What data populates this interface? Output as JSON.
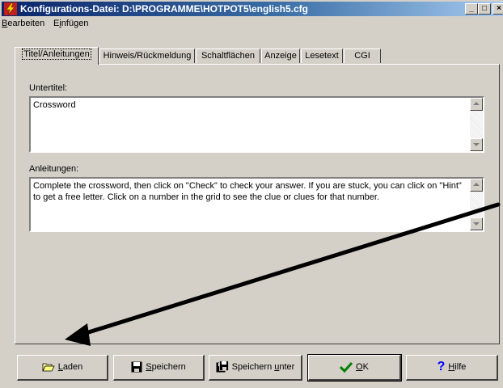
{
  "window": {
    "title": "Konfigurations-Datei: D:\\PROGRAMME\\HOTPOT5\\english5.cfg",
    "controls": {
      "minimize": "_",
      "maximize": "□",
      "close": "×"
    }
  },
  "menu": {
    "items": [
      {
        "label": "Bearbeiten",
        "mnemonic": "B",
        "rest": "earbeiten"
      },
      {
        "label": "Einfügen",
        "mnemonic": "i",
        "pre": "E",
        "rest": "nfügen"
      }
    ]
  },
  "tabs": [
    {
      "label": "Titel/Anleitungen",
      "active": true
    },
    {
      "label": "Hinweis/Rückmeldung",
      "active": false
    },
    {
      "label": "Schaltflächen",
      "active": false
    },
    {
      "label": "Anzeige",
      "active": false
    },
    {
      "label": "Lesetext",
      "active": false
    },
    {
      "label": "CGI",
      "active": false
    }
  ],
  "subtitle": {
    "label": "Untertitel:",
    "value": "Crossword"
  },
  "instructions": {
    "label": "Anleitungen:",
    "value": "Complete the crossword, then click on \"Check\" to check your answer. If you are stuck, you can click on \"Hint\" to get a free letter. Click on a number in the grid to see the clue or clues for that number."
  },
  "buttons": {
    "load": {
      "pre": "",
      "mnemonic": "L",
      "rest": "aden",
      "icon": "folder-open-icon"
    },
    "save": {
      "pre": "",
      "mnemonic": "S",
      "rest": "peichern",
      "icon": "floppy-disk-icon"
    },
    "save_as": {
      "pre": "Speichern ",
      "mnemonic": "u",
      "rest": "nter",
      "icon": "floppy-disk-save-as-icon"
    },
    "ok": {
      "pre": "",
      "mnemonic": "O",
      "rest": "K",
      "icon": "checkmark-icon",
      "icon_color": "#008000"
    },
    "help": {
      "pre": "",
      "mnemonic": "H",
      "rest": "ilfe",
      "icon": "question-mark-icon",
      "icon_color": "#0000ff"
    }
  },
  "colors": {
    "titlebar_start": "#0a246a",
    "titlebar_end": "#a6caf0",
    "face": "#d4d0c8"
  }
}
